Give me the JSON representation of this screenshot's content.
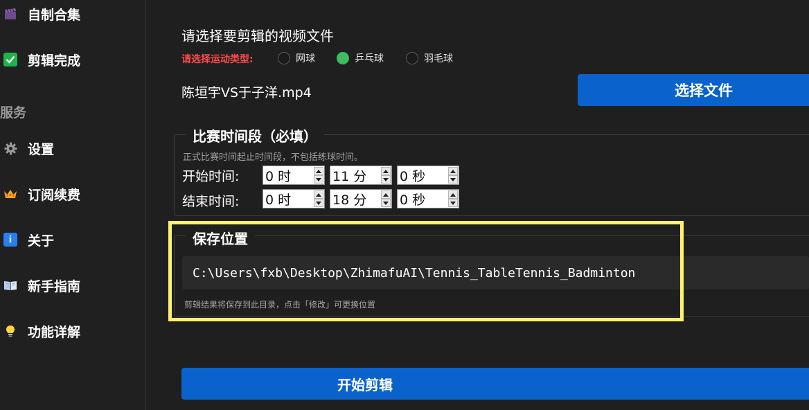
{
  "sidebar": {
    "items_top": [
      {
        "label": "自制合集",
        "icon": "clapperboard-icon"
      },
      {
        "label": "剪辑完成",
        "icon": "check-square-icon"
      }
    ],
    "section_title": "服务",
    "items": [
      {
        "label": "设置",
        "icon": "gear-icon"
      },
      {
        "label": "订阅续费",
        "icon": "crown-icon"
      },
      {
        "label": "关于",
        "icon": "info-icon"
      },
      {
        "label": "新手指南",
        "icon": "book-icon"
      },
      {
        "label": "功能详解",
        "icon": "lightbulb-icon"
      }
    ]
  },
  "main": {
    "title": "请选择要剪辑的视频文件",
    "sport_label": "请选择运动类型:",
    "sports": [
      {
        "label": "网球",
        "checked": false
      },
      {
        "label": "乒乓球",
        "checked": true
      },
      {
        "label": "羽毛球",
        "checked": false
      }
    ],
    "file_name": "陈垣宇VS于子洋.mp4",
    "choose_button": "选择文件",
    "match_time": {
      "title": "比赛时间段（必填）",
      "hint": "正式比赛时间起止时间段，不包括练球时间。",
      "start_label": "开始时间:",
      "end_label": "结束时间:",
      "start": {
        "hours": "0 时",
        "minutes": "11 分",
        "seconds": "0 秒"
      },
      "end": {
        "hours": "0 时",
        "minutes": "18 分",
        "seconds": "0 秒"
      }
    },
    "save": {
      "title": "保存位置",
      "path": "C:\\Users\\fxb\\Desktop\\ZhimafuAI\\Tennis_TableTennis_Badminton",
      "hint": "剪辑结果将保存到此目录，点击「修改」可更换位置"
    },
    "start_button": "开始剪辑"
  },
  "colors": {
    "accent_blue": "#0a62cc",
    "radio_checked": "#3dbb5e",
    "warning_red": "#ff4a4a",
    "highlight_yellow": "#fdf16e"
  }
}
